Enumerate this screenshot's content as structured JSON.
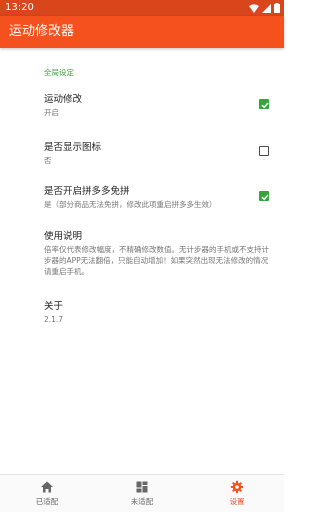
{
  "status_bar": {
    "time": "13:20"
  },
  "app_bar": {
    "title": "运动修改器",
    "color": "#f4511e"
  },
  "settings": {
    "section_header": "全局设定",
    "items": [
      {
        "title": "运动修改",
        "summary": "开启",
        "checked": true
      },
      {
        "title": "是否显示图标",
        "summary": "否",
        "checked": false
      },
      {
        "title": "是否开启拼多多免拼",
        "summary": "是（部分商品无法免拼，修改此项重启拼多多生效）",
        "checked": true
      },
      {
        "title": "使用说明",
        "summary": "倍率仅代表修改幅度，不精确修改数值。无计步器的手机或不支持计步器的APP无法翻倍，只能自动增加！如果突然出现无法修改的情况请重启手机。"
      },
      {
        "title": "关于",
        "summary": "2.1.7"
      }
    ]
  },
  "bottom_nav": {
    "items": [
      {
        "label": "已适配",
        "icon": "home-icon",
        "active": false
      },
      {
        "label": "未适配",
        "icon": "dashboard-icon",
        "active": false
      },
      {
        "label": "设置",
        "icon": "gear-icon",
        "active": true
      }
    ]
  }
}
